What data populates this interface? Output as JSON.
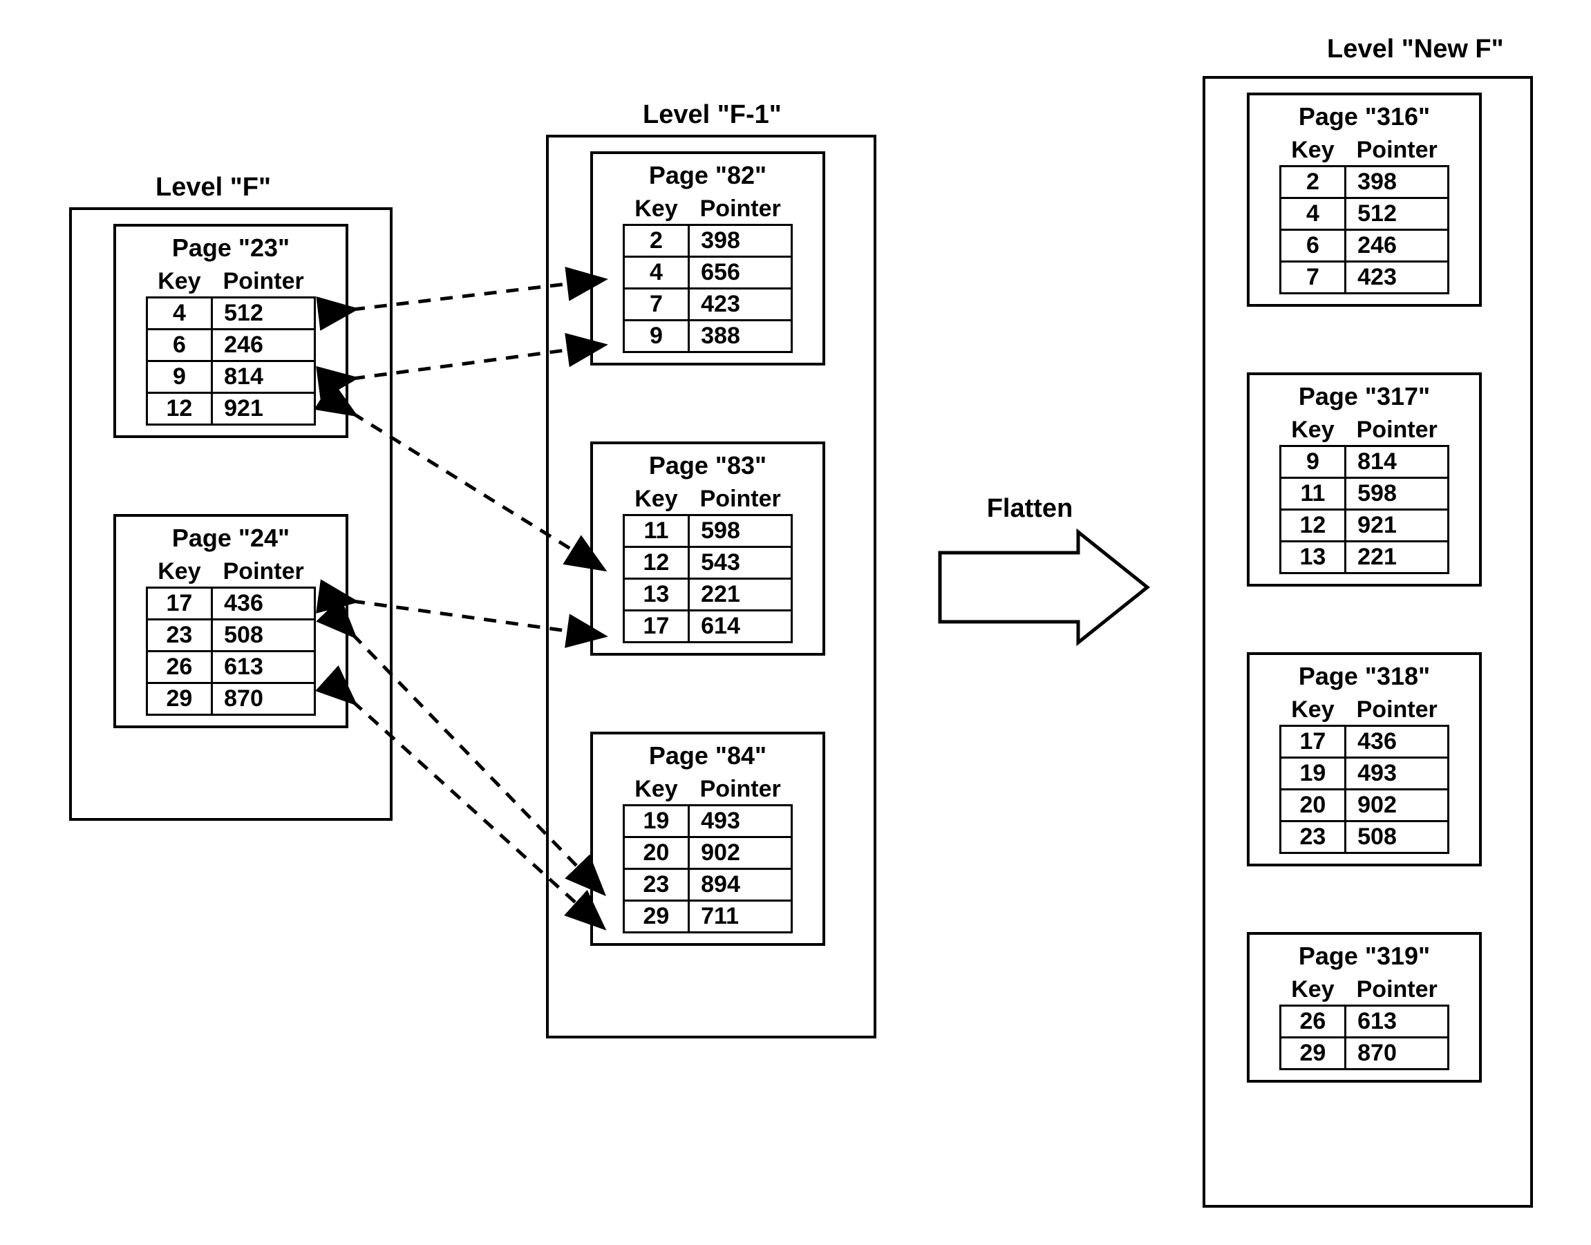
{
  "labels": {
    "flatten": "Flatten",
    "key": "Key",
    "pointer": "Pointer",
    "page_prefix": "Page"
  },
  "levels": {
    "F": {
      "title": "Level \"F\"",
      "pages": [
        {
          "id": "23",
          "title": "Page \"23\"",
          "rows": [
            {
              "key": "4",
              "ptr": "512"
            },
            {
              "key": "6",
              "ptr": "246"
            },
            {
              "key": "9",
              "ptr": "814"
            },
            {
              "key": "12",
              "ptr": "921"
            }
          ]
        },
        {
          "id": "24",
          "title": "Page \"24\"",
          "rows": [
            {
              "key": "17",
              "ptr": "436"
            },
            {
              "key": "23",
              "ptr": "508"
            },
            {
              "key": "26",
              "ptr": "613"
            },
            {
              "key": "29",
              "ptr": "870"
            }
          ]
        }
      ]
    },
    "F_1": {
      "title": "Level \"F-1\"",
      "pages": [
        {
          "id": "82",
          "title": "Page \"82\"",
          "rows": [
            {
              "key": "2",
              "ptr": "398"
            },
            {
              "key": "4",
              "ptr": "656"
            },
            {
              "key": "7",
              "ptr": "423"
            },
            {
              "key": "9",
              "ptr": "388"
            }
          ]
        },
        {
          "id": "83",
          "title": "Page \"83\"",
          "rows": [
            {
              "key": "11",
              "ptr": "598"
            },
            {
              "key": "12",
              "ptr": "543"
            },
            {
              "key": "13",
              "ptr": "221"
            },
            {
              "key": "17",
              "ptr": "614"
            }
          ]
        },
        {
          "id": "84",
          "title": "Page \"84\"",
          "rows": [
            {
              "key": "19",
              "ptr": "493"
            },
            {
              "key": "20",
              "ptr": "902"
            },
            {
              "key": "23",
              "ptr": "894"
            },
            {
              "key": "29",
              "ptr": "711"
            }
          ]
        }
      ]
    },
    "NewF": {
      "title": "Level \"New F\"",
      "pages": [
        {
          "id": "316",
          "title": "Page \"316\"",
          "rows": [
            {
              "key": "2",
              "ptr": "398"
            },
            {
              "key": "4",
              "ptr": "512"
            },
            {
              "key": "6",
              "ptr": "246"
            },
            {
              "key": "7",
              "ptr": "423"
            }
          ]
        },
        {
          "id": "317",
          "title": "Page \"317\"",
          "rows": [
            {
              "key": "9",
              "ptr": "814"
            },
            {
              "key": "11",
              "ptr": "598"
            },
            {
              "key": "12",
              "ptr": "921"
            },
            {
              "key": "13",
              "ptr": "221"
            }
          ]
        },
        {
          "id": "318",
          "title": "Page \"318\"",
          "rows": [
            {
              "key": "17",
              "ptr": "436"
            },
            {
              "key": "19",
              "ptr": "493"
            },
            {
              "key": "20",
              "ptr": "902"
            },
            {
              "key": "23",
              "ptr": "508"
            }
          ]
        },
        {
          "id": "319",
          "title": "Page \"319\"",
          "rows": [
            {
              "key": "26",
              "ptr": "613"
            },
            {
              "key": "29",
              "ptr": "870"
            }
          ]
        }
      ]
    }
  },
  "arrows": [
    {
      "from": "F.23.row0",
      "to": "F_1.82.row1"
    },
    {
      "from": "F.23.row2",
      "to": "F_1.82.row3"
    },
    {
      "from": "F.23.row3",
      "to": "F_1.83.row1"
    },
    {
      "from": "F.24.row0",
      "to": "F_1.83.row3"
    },
    {
      "from": "F.24.row1",
      "to": "F_1.84.row2"
    },
    {
      "from": "F.24.row3",
      "to": "F_1.84.row3"
    }
  ]
}
